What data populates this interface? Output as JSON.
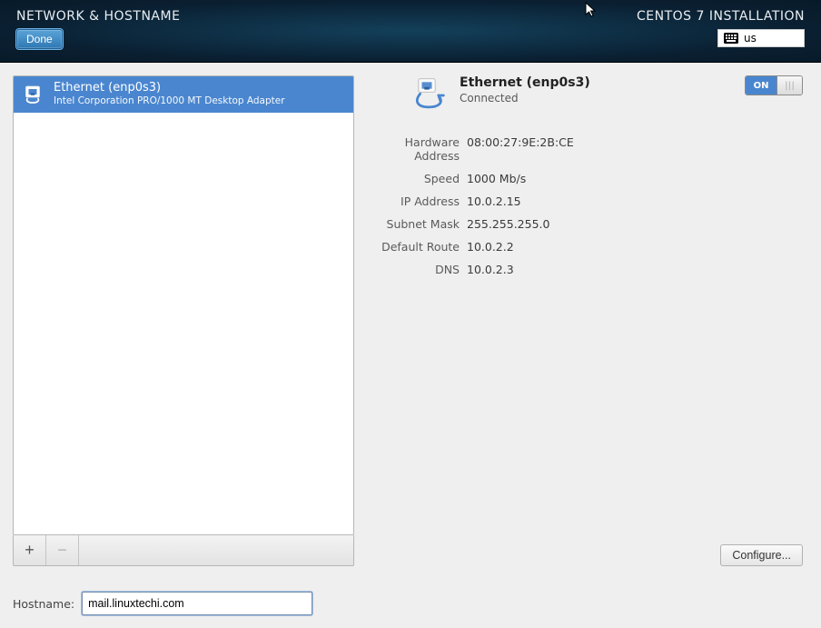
{
  "header": {
    "spoke_title": "NETWORK & HOSTNAME",
    "done_label": "Done",
    "installer_title": "CENTOS 7 INSTALLATION",
    "keyboard_layout": "us"
  },
  "device_list": [
    {
      "name": "Ethernet (enp0s3)",
      "adapter": "Intel Corporation PRO/1000 MT Desktop Adapter",
      "selected": true
    }
  ],
  "list_toolbar": {
    "add_label": "+",
    "remove_label": "−"
  },
  "details": {
    "interface_title": "Ethernet (enp0s3)",
    "status": "Connected",
    "switch_on_label": "ON",
    "switch_state": "on",
    "rows": {
      "hw_label": "Hardware Address",
      "hw_value": "08:00:27:9E:2B:CE",
      "speed_label": "Speed",
      "speed_value": "1000 Mb/s",
      "ip_label": "IP Address",
      "ip_value": "10.0.2.15",
      "mask_label": "Subnet Mask",
      "mask_value": "255.255.255.0",
      "route_label": "Default Route",
      "route_value": "10.0.2.2",
      "dns_label": "DNS",
      "dns_value": "10.0.2.3"
    },
    "configure_label": "Configure..."
  },
  "hostname": {
    "label": "Hostname:",
    "value": "mail.linuxtechi.com"
  }
}
